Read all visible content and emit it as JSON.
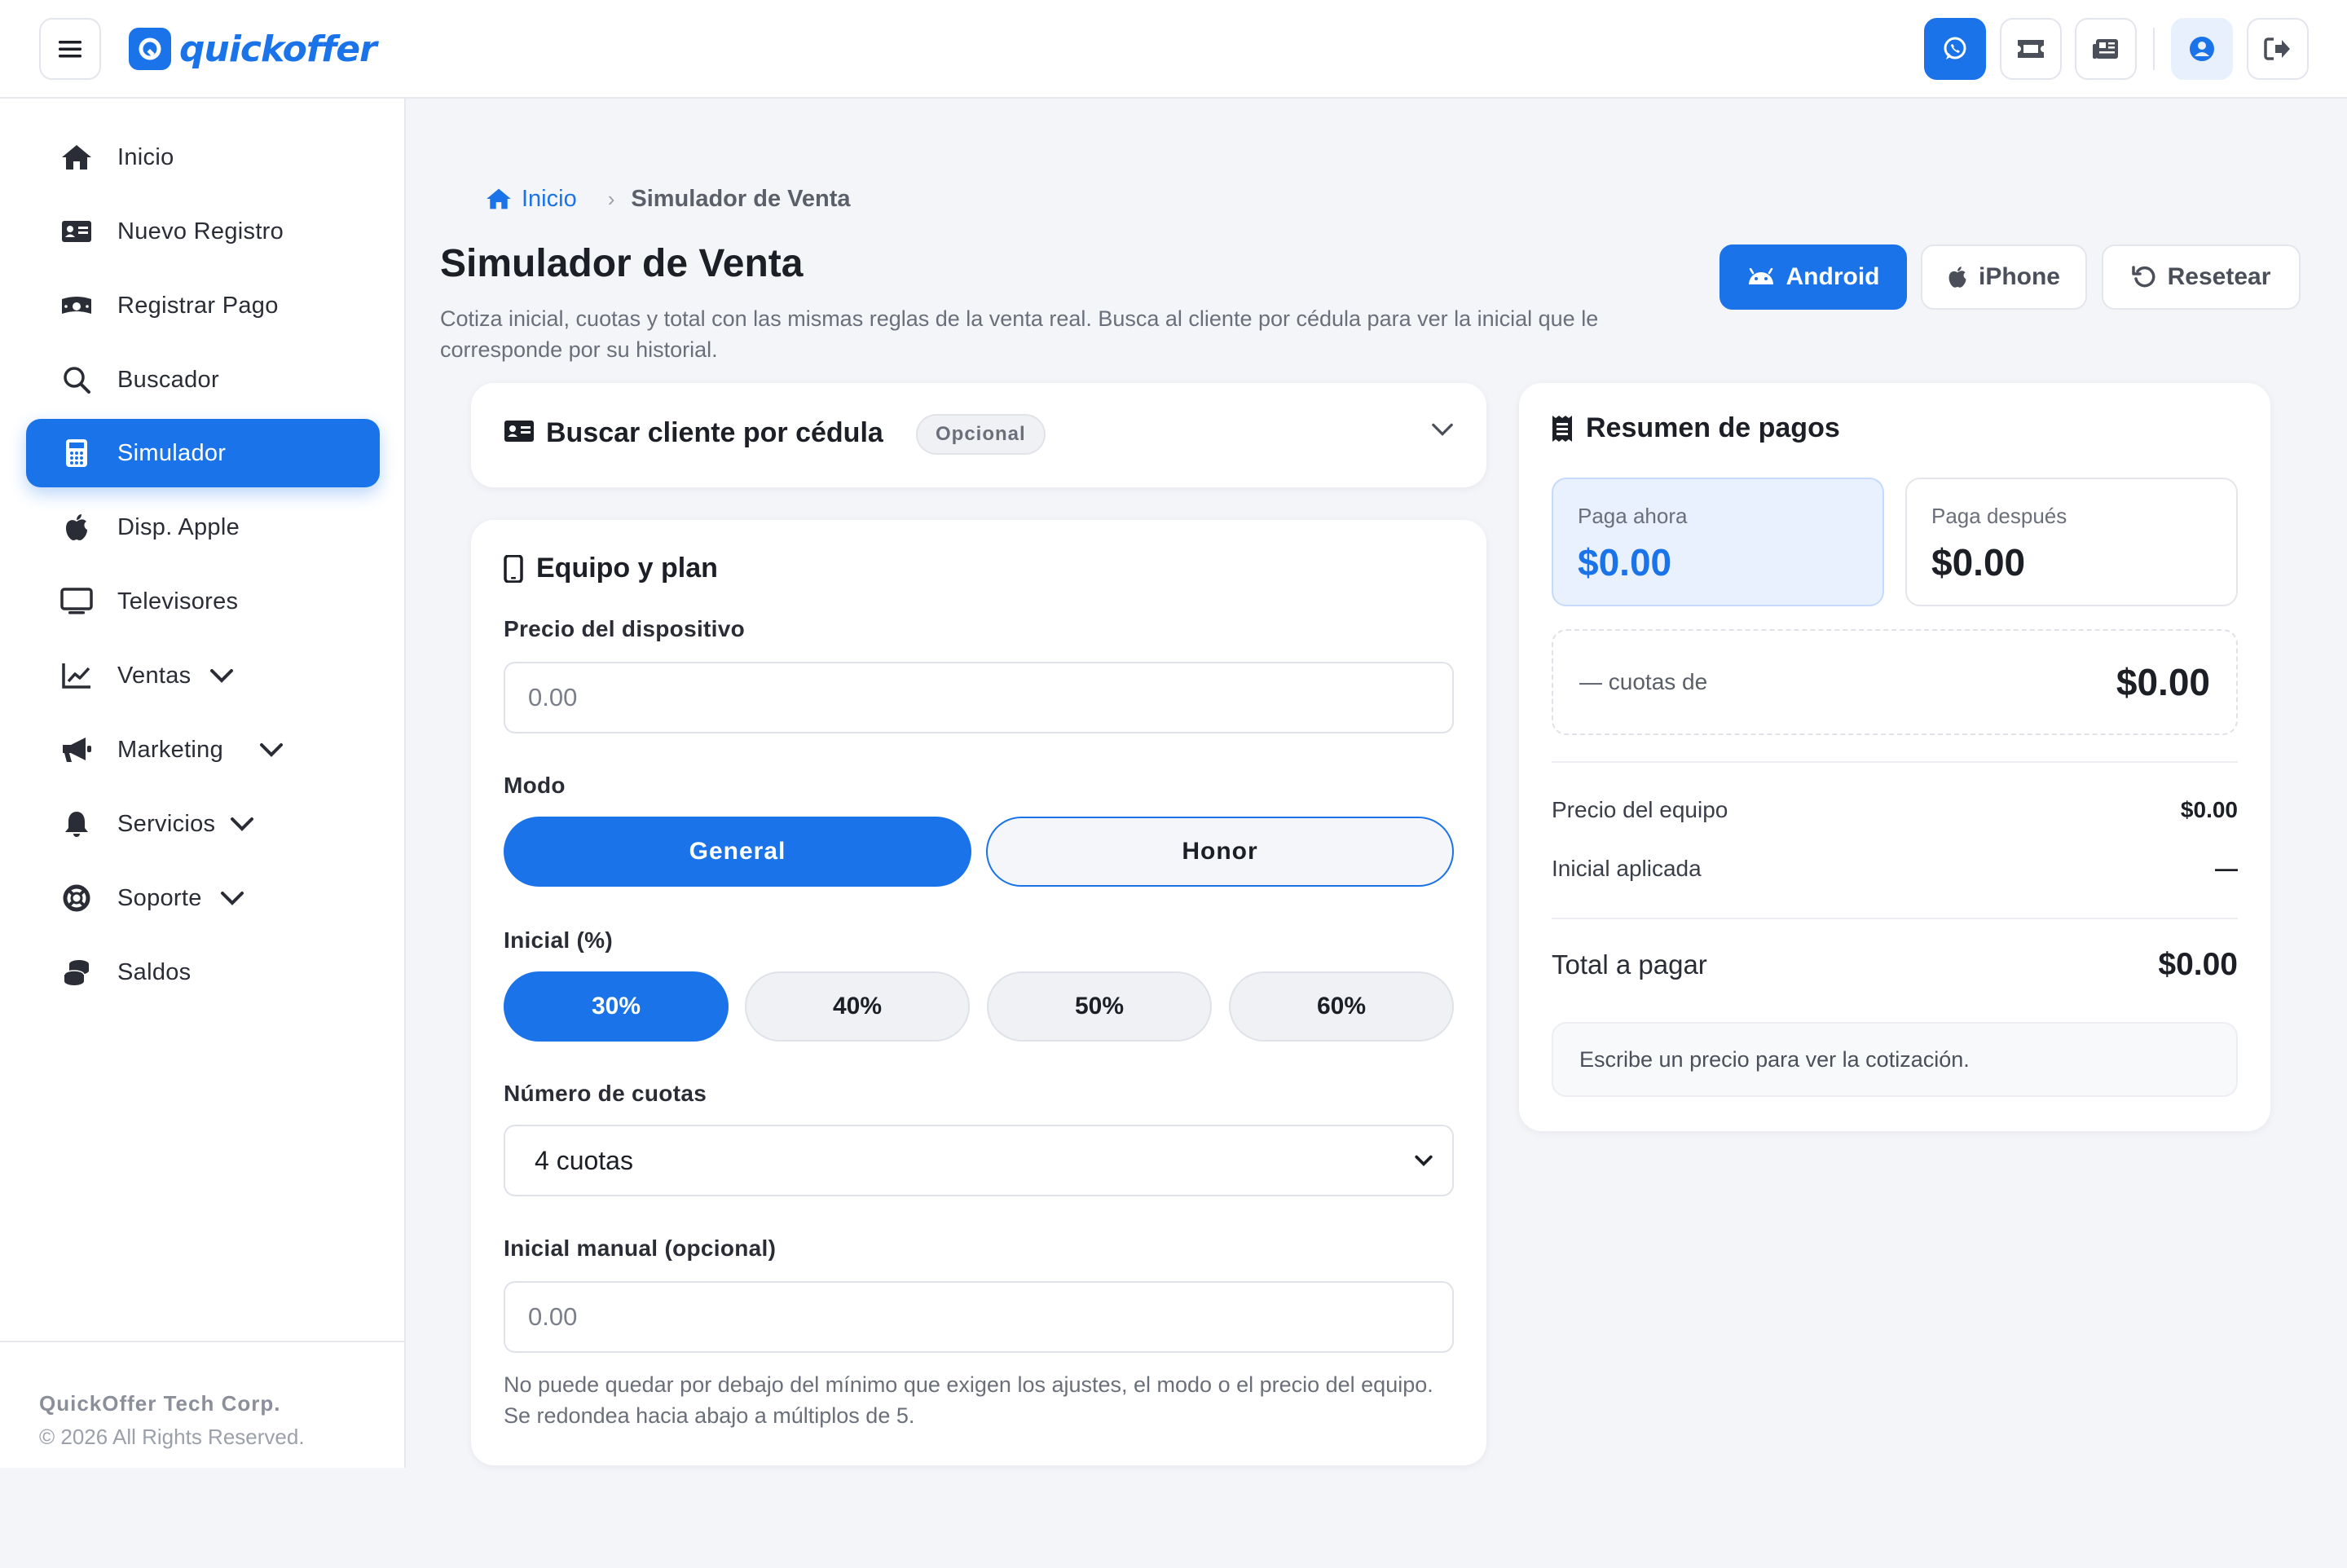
{
  "app": {
    "brand": "quickoffer"
  },
  "sidebar": {
    "items": [
      {
        "label": "Inicio",
        "icon": "home-icon"
      },
      {
        "label": "Nuevo Registro",
        "icon": "id-card-icon"
      },
      {
        "label": "Registrar Pago",
        "icon": "money-bill-icon"
      },
      {
        "label": "Buscador",
        "icon": "search-icon"
      },
      {
        "label": "Simulador",
        "icon": "calculator-icon",
        "active": true
      },
      {
        "label": "Disp. Apple",
        "icon": "apple-icon"
      },
      {
        "label": "Televisores",
        "icon": "tv-icon"
      },
      {
        "label": "Ventas",
        "icon": "chart-line-icon"
      },
      {
        "label": "Marketing",
        "icon": "bullhorn-icon"
      },
      {
        "label": "Servicios",
        "icon": "bell-icon"
      },
      {
        "label": "Soporte",
        "icon": "life-ring-icon"
      },
      {
        "label": "Saldos",
        "icon": "coins-icon"
      }
    ],
    "footer": {
      "company": "QuickOffer Tech Corp.",
      "copyright": "© 2026 All Rights Reserved."
    }
  },
  "breadcrumb": {
    "home": "Inicio",
    "current": "Simulador de Venta"
  },
  "page": {
    "title": "Simulador de Venta",
    "description": "Cotiza inicial, cuotas y total con las mismas reglas de la venta real. Busca al cliente por cédula para ver la inicial que le corresponde por su historial."
  },
  "header_buttons": {
    "android": "Android",
    "iphone": "iPhone",
    "reset": "Resetear"
  },
  "search_card": {
    "title": "Buscar cliente por cédula",
    "badge": "Opcional"
  },
  "equip_card": {
    "title": "Equipo y plan",
    "price_label": "Precio del dispositivo",
    "price_placeholder": "0.00",
    "mode_label": "Modo",
    "mode_general": "General",
    "mode_honor": "Honor",
    "inicial_label": "Inicial (%)",
    "percents": [
      "30%",
      "40%",
      "50%",
      "60%"
    ],
    "selected_percent": "30%",
    "cuotas_label": "Número de cuotas",
    "cuotas_value": "4 cuotas",
    "manual_label": "Inicial manual (opcional)",
    "manual_placeholder": "0.00",
    "help": "No puede quedar por debajo del mínimo que exigen los ajustes, el modo o el precio del equipo. Se redondea hacia abajo a múltiplos de 5."
  },
  "summary": {
    "title": "Resumen de pagos",
    "paga_ahora_label": "Paga ahora",
    "paga_ahora_value": "$0.00",
    "paga_despues_label": "Paga después",
    "paga_despues_value": "$0.00",
    "cuotas_label": "— cuotas de",
    "cuotas_value": "$0.00",
    "precio_equipo_label": "Precio del equipo",
    "precio_equipo_value": "$0.00",
    "inicial_aplicada_label": "Inicial aplicada",
    "inicial_aplicada_value": "—",
    "total_label": "Total a pagar",
    "total_value": "$0.00",
    "info": "Escribe un precio para ver la cotización."
  },
  "colors": {
    "accent": "#1a73e8",
    "background": "#f4f5f9",
    "text": "#1c1f26"
  }
}
